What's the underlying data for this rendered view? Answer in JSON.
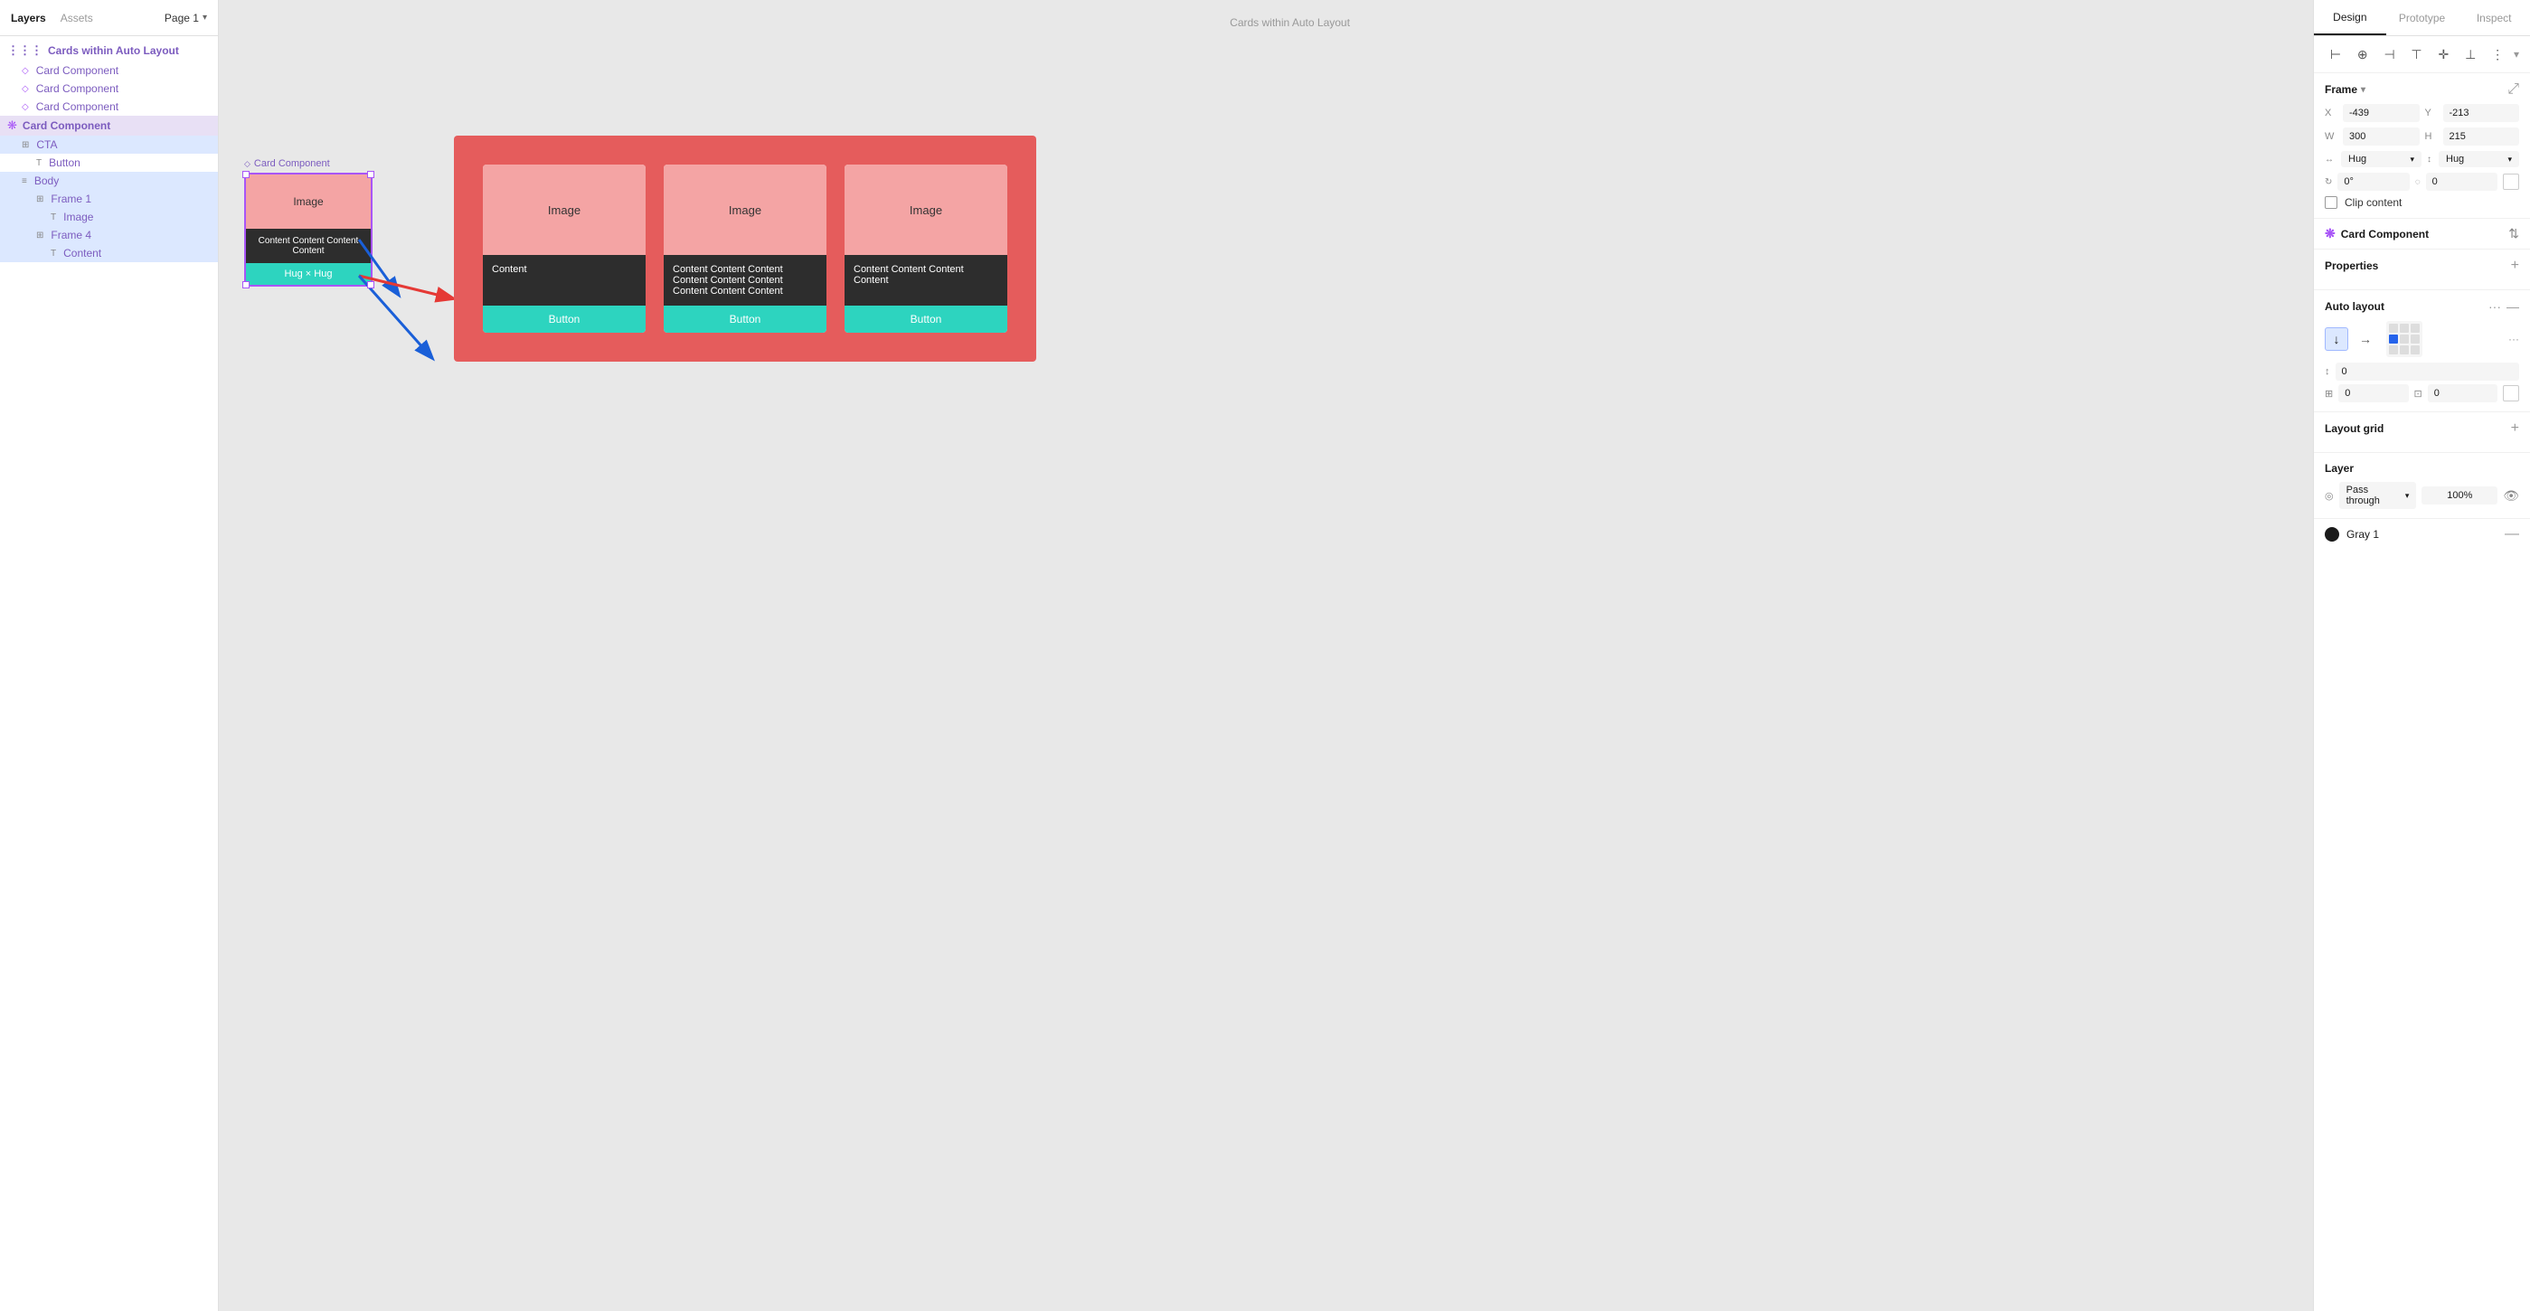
{
  "leftPanel": {
    "tabs": [
      {
        "label": "Layers",
        "active": true
      },
      {
        "label": "Assets",
        "active": false
      }
    ],
    "pageSelector": "Page 1",
    "groupTitle": "Cards within Auto Layout",
    "layers": [
      {
        "id": 1,
        "label": "Card Component",
        "type": "sym",
        "indent": 1,
        "selected": false
      },
      {
        "id": 2,
        "label": "Card Component",
        "type": "sym",
        "indent": 1,
        "selected": false
      },
      {
        "id": 3,
        "label": "Card Component",
        "type": "sym",
        "indent": 1,
        "selected": false
      },
      {
        "id": 4,
        "label": "Card Component",
        "type": "comp",
        "indent": 0,
        "selected": true
      },
      {
        "id": 5,
        "label": "CTA",
        "type": "frame",
        "indent": 1,
        "selected": false
      },
      {
        "id": 6,
        "label": "Button",
        "type": "text",
        "indent": 2,
        "selected": false
      },
      {
        "id": 7,
        "label": "Body",
        "type": "frame",
        "indent": 1,
        "selected": false
      },
      {
        "id": 8,
        "label": "Frame 1",
        "type": "frame",
        "indent": 2,
        "selected": false
      },
      {
        "id": 9,
        "label": "Image",
        "type": "text",
        "indent": 3,
        "selected": false
      },
      {
        "id": 10,
        "label": "Frame 4",
        "type": "frame",
        "indent": 2,
        "selected": false
      },
      {
        "id": 11,
        "label": "Content",
        "type": "text",
        "indent": 3,
        "selected": false
      }
    ]
  },
  "canvas": {
    "frameLabel": "Cards within Auto Layout",
    "cardFloatLabel": "Card Component",
    "card1": {
      "imageText": "Image",
      "contentText": "Content Content Content Content",
      "buttonText": "Hug × Hug"
    },
    "cards": [
      {
        "imageText": "Image",
        "contentText": "Content",
        "buttonText": "Button"
      },
      {
        "imageText": "Image",
        "contentText": "Content Content Content Content Content Content Content Content Content",
        "buttonText": "Button"
      },
      {
        "imageText": "Image",
        "contentText": "Content Content Content Content",
        "buttonText": "Button"
      }
    ]
  },
  "rightPanel": {
    "tabs": [
      "Design",
      "Prototype",
      "Inspect"
    ],
    "activeTab": "Design",
    "alignButtons": [
      "⊢",
      "+",
      "⊣",
      "⊤",
      "✛",
      "⊥",
      "|||"
    ],
    "frame": {
      "title": "Frame",
      "x": "-439",
      "y": "-213",
      "w": "300",
      "h": "215",
      "wMode": "Hug",
      "hMode": "Hug",
      "rotation": "0°",
      "cornerRadius": "0",
      "clipContent": false
    },
    "component": {
      "name": "Card Component"
    },
    "properties": {
      "title": "Properties",
      "addLabel": "+"
    },
    "autoLayout": {
      "title": "Auto layout",
      "direction": "vertical",
      "spacing": "0",
      "paddingH": "0",
      "paddingV": "0"
    },
    "layoutGrid": {
      "title": "Layout grid",
      "addLabel": "+"
    },
    "layer": {
      "title": "Layer",
      "blendMode": "Pass through",
      "opacity": "100%",
      "visible": true
    },
    "fill": {
      "color": "#1a1a1a",
      "label": "Gray 1",
      "action": "—"
    }
  }
}
